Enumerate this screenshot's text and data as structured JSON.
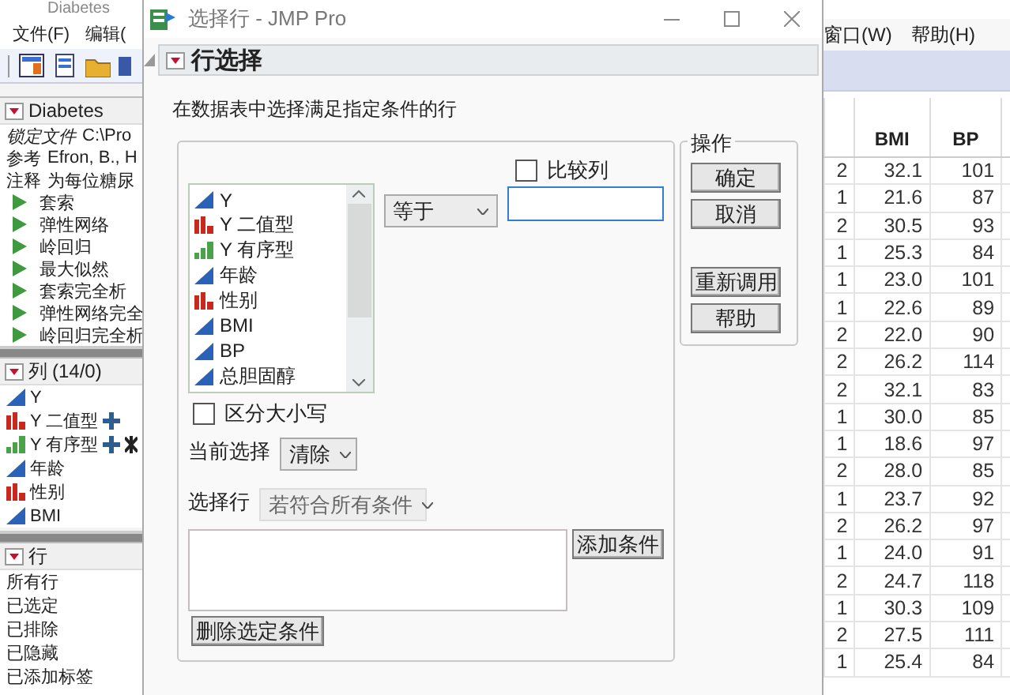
{
  "background_window": {
    "title": "Diabetes",
    "menu_left": [
      "文件(F)",
      "编辑("
    ],
    "menu_right": [
      "窗口(W)",
      "帮助(H)"
    ]
  },
  "table_panel": {
    "title": "Diabetes",
    "info": [
      {
        "label": "锁定文件",
        "value": "C:\\Pro",
        "italic": true
      },
      {
        "label": "参考",
        "value": "Efron, B., H",
        "italic": false
      },
      {
        "label": "注释",
        "value": "为每位糖尿",
        "italic": false
      }
    ],
    "scripts": [
      "套索",
      "弹性网络",
      "岭回归",
      "最大似然",
      "套索完全析",
      "弹性网络完全",
      "岭回归完全析"
    ]
  },
  "columns_panel": {
    "title": "列",
    "count": "(14/0)",
    "columns": [
      {
        "name": "Y",
        "kind": "continuous",
        "property_icon": false,
        "formula_icon": false
      },
      {
        "name": "Y 二值型",
        "kind": "nominal",
        "property_icon": true,
        "formula_icon": false
      },
      {
        "name": "Y 有序型",
        "kind": "ordinal",
        "property_icon": true,
        "formula_icon": true
      },
      {
        "name": "年龄",
        "kind": "continuous",
        "property_icon": false,
        "formula_icon": false
      },
      {
        "name": "性别",
        "kind": "nominal",
        "property_icon": false,
        "formula_icon": false
      },
      {
        "name": "BMI",
        "kind": "continuous",
        "property_icon": false,
        "formula_icon": false
      }
    ]
  },
  "rows_panel": {
    "title": "行",
    "items": [
      "所有行",
      "已选定",
      "已排除",
      "已隐藏",
      "已添加标签"
    ]
  },
  "dialog": {
    "title": "选择行 - JMP Pro",
    "outline_title": "行选择",
    "description": "在数据表中选择满足指定条件的行",
    "column_list": [
      {
        "name": "Y",
        "kind": "continuous"
      },
      {
        "name": "Y 二值型",
        "kind": "nominal"
      },
      {
        "name": "Y 有序型",
        "kind": "ordinal"
      },
      {
        "name": "年龄",
        "kind": "continuous"
      },
      {
        "name": "性别",
        "kind": "nominal"
      },
      {
        "name": "BMI",
        "kind": "continuous"
      },
      {
        "name": "BP",
        "kind": "continuous"
      },
      {
        "name": "总胆固醇",
        "kind": "continuous"
      }
    ],
    "operator": "等于",
    "compare_columns": {
      "label": "比较列",
      "checked": false
    },
    "match_case": {
      "label": "区分大小写",
      "checked": false
    },
    "current_selection": {
      "label": "当前选择",
      "value": "清除"
    },
    "select_rows": {
      "label": "选择行",
      "value": "若符合所有条件",
      "disabled": true
    },
    "add_condition": "添加条件",
    "delete_condition": "删除选定条件",
    "actions_title": "操作",
    "actions": [
      "确定",
      "取消",
      "重新调用",
      "帮助"
    ]
  },
  "data_table": {
    "headers": [
      "BMI",
      "BP"
    ],
    "rows": [
      [
        "2",
        "32.1",
        "101"
      ],
      [
        "1",
        "21.6",
        "87"
      ],
      [
        "2",
        "30.5",
        "93"
      ],
      [
        "1",
        "25.3",
        "84"
      ],
      [
        "1",
        "23.0",
        "101"
      ],
      [
        "1",
        "22.6",
        "89"
      ],
      [
        "2",
        "22.0",
        "90"
      ],
      [
        "2",
        "26.2",
        "114"
      ],
      [
        "2",
        "32.1",
        "83"
      ],
      [
        "1",
        "30.0",
        "85"
      ],
      [
        "1",
        "18.6",
        "97"
      ],
      [
        "2",
        "28.0",
        "85"
      ],
      [
        "1",
        "23.7",
        "92"
      ],
      [
        "2",
        "26.2",
        "97"
      ],
      [
        "1",
        "24.0",
        "91"
      ],
      [
        "2",
        "24.7",
        "118"
      ],
      [
        "1",
        "30.3",
        "109"
      ],
      [
        "2",
        "27.5",
        "111"
      ],
      [
        "1",
        "25.4",
        "84"
      ]
    ]
  }
}
